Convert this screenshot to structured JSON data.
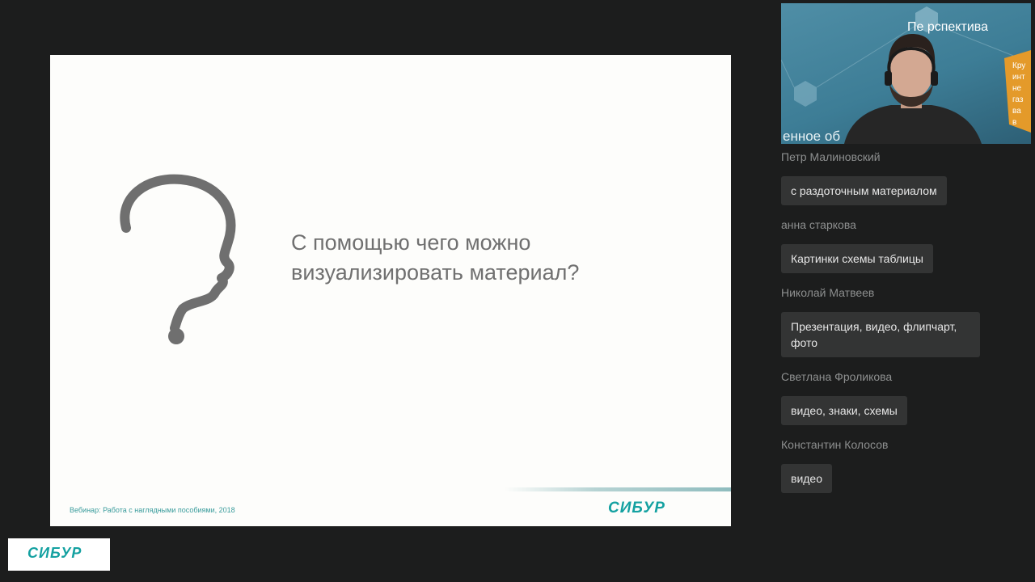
{
  "slide": {
    "question": "С помощью чего можно визуализировать материал?",
    "footer_text": "Вебинар: Работа с наглядными пособиями, 2018",
    "logo": "СИБУР"
  },
  "bottom_logo": "СИБУР",
  "video": {
    "banner_text": "Пе  рспектива",
    "wall_text": "енное об",
    "side_text": [
      "Кру",
      "инт",
      "не",
      "газ",
      "ва",
      "в"
    ]
  },
  "chat": [
    {
      "author": "Петр Малиновский",
      "message": "с раздоточным материалом"
    },
    {
      "author": "анна старкова",
      "message": "Картинки схемы таблицы"
    },
    {
      "author": "Николай Матвеев",
      "message": "Презентация, видео, флипчарт, фото"
    },
    {
      "author": "Светлана Фроликова",
      "message": "видео, знаки, схемы"
    },
    {
      "author": "Константин Колосов",
      "message": "видео"
    }
  ]
}
